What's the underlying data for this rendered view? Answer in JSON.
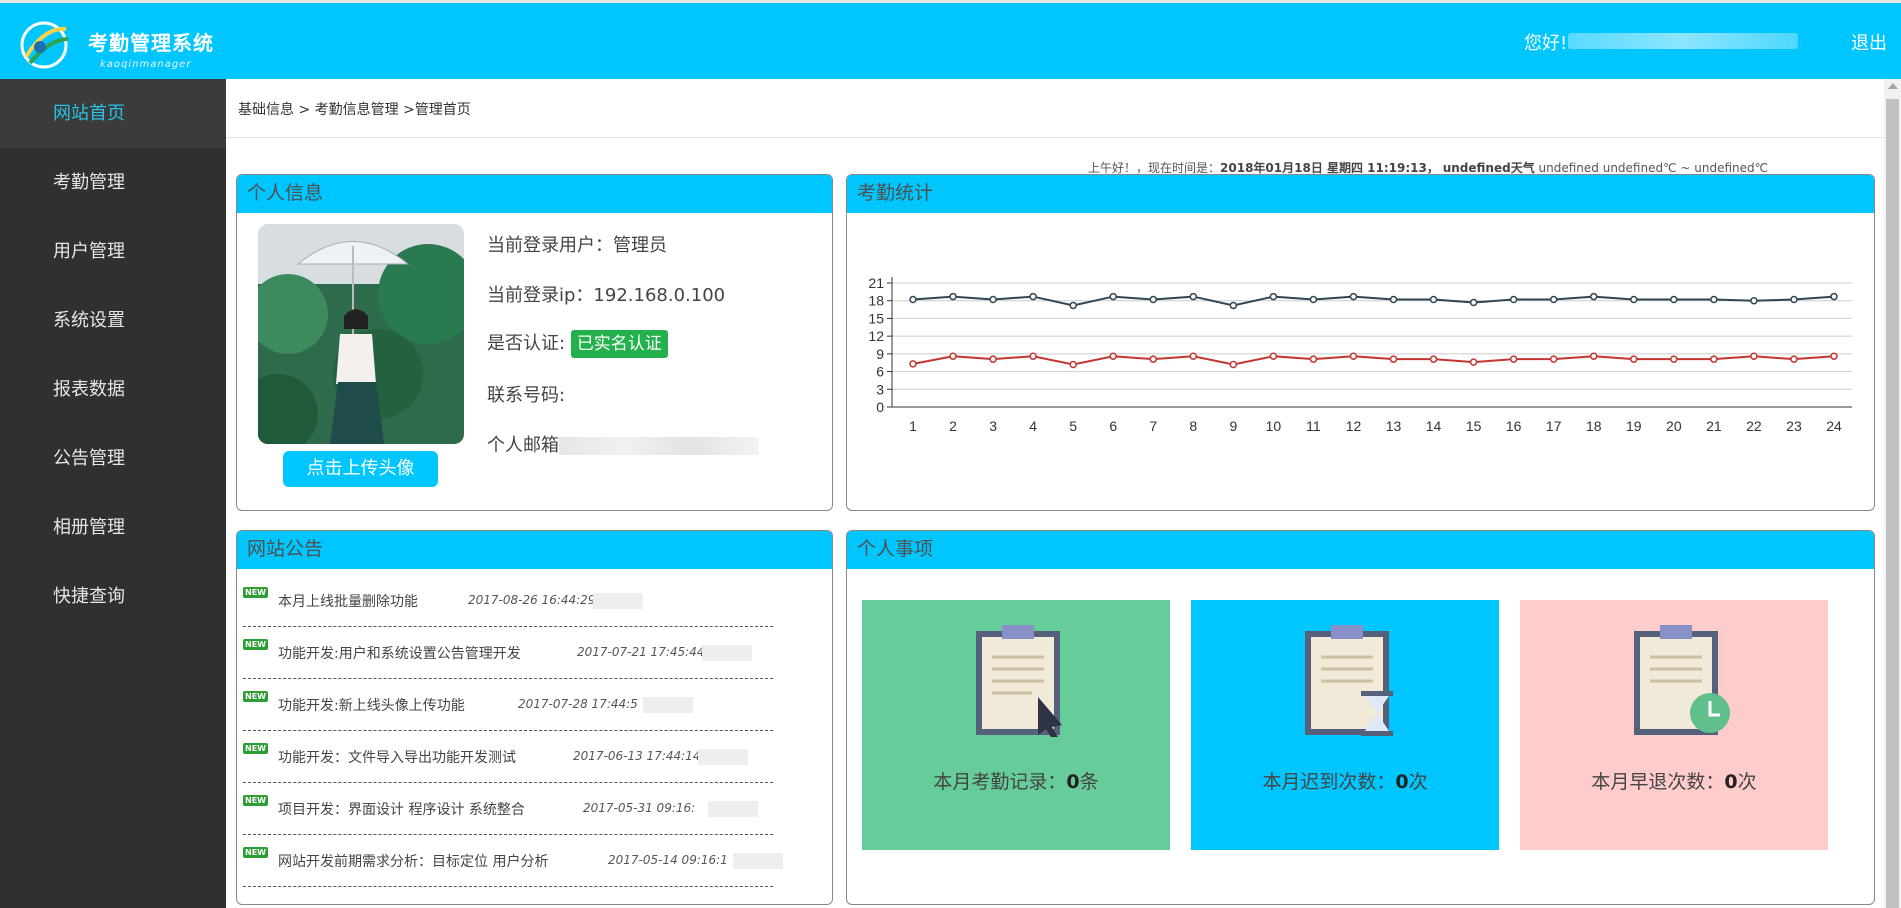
{
  "header": {
    "title": "考勤管理系统",
    "subtitle": "kaoqinmanager",
    "greeting": "您好!",
    "logout": "退出"
  },
  "sidebar": {
    "items": [
      {
        "label": "网站首页",
        "active": true
      },
      {
        "label": "考勤管理"
      },
      {
        "label": "用户管理"
      },
      {
        "label": "系统设置"
      },
      {
        "label": "报表数据"
      },
      {
        "label": "公告管理"
      },
      {
        "label": "相册管理"
      },
      {
        "label": "快捷查询"
      }
    ]
  },
  "breadcrumb": "基础信息 > 考勤信息管理 >管理首页",
  "timebar": {
    "prefix": "上午好！，现在时间是：",
    "datetime": "2018年01月18日 星期四 11:19:13",
    "sep": "，",
    "weather": "undefined天气",
    "temps": " undefined undefined℃ ~ undefined℃"
  },
  "profile": {
    "heading": "个人信息",
    "user": "当前登录用户：管理员",
    "ip": "当前登录ip：192.168.0.100",
    "auth_label": "是否认证:",
    "auth_badge": "已实名认证",
    "phone": "联系号码:",
    "email": "个人邮箱",
    "upload_button": "点击上传头像"
  },
  "stats": {
    "heading": "考勤统计"
  },
  "chart_data": {
    "type": "line",
    "x": [
      1,
      2,
      3,
      4,
      5,
      6,
      7,
      8,
      9,
      10,
      11,
      12,
      13,
      14,
      15,
      16,
      17,
      18,
      19,
      20,
      21,
      22,
      23,
      24
    ],
    "ylim": [
      0,
      21
    ],
    "yticks": [
      0,
      3,
      6,
      9,
      12,
      15,
      18,
      21
    ],
    "grid": true,
    "series": [
      {
        "color": "#2f4554",
        "values": [
          18.2,
          18.7,
          18.2,
          18.7,
          17.2,
          18.7,
          18.2,
          18.7,
          17.2,
          18.7,
          18.2,
          18.7,
          18.2,
          18.2,
          17.7,
          18.2,
          18.2,
          18.7,
          18.2,
          18.2,
          18.2,
          18.0,
          18.2,
          18.7
        ]
      },
      {
        "color": "#c23531",
        "values": [
          7.3,
          8.6,
          8.1,
          8.6,
          7.2,
          8.6,
          8.1,
          8.6,
          7.2,
          8.6,
          8.1,
          8.6,
          8.1,
          8.1,
          7.6,
          8.1,
          8.1,
          8.6,
          8.1,
          8.1,
          8.1,
          8.6,
          8.1,
          8.6
        ]
      }
    ]
  },
  "notices": {
    "heading": "网站公告",
    "new_label": "NEW",
    "items": [
      {
        "title": "本月上线批量删除功能",
        "date": "2017-08-26 16:44:29"
      },
      {
        "title": "功能开发:用户和系统设置公告管理开发",
        "date": "2017-07-21 17:45:44"
      },
      {
        "title": "功能开发:新上线头像上传功能",
        "date": "2017-07-28 17:44:5"
      },
      {
        "title": "功能开发：文件导入导出功能开发测试",
        "date": "2017-06-13 17:44:14"
      },
      {
        "title": "项目开发：界面设计 程序设计 系统整合",
        "date": "2017-05-31 09:16:"
      },
      {
        "title": "网站开发前期需求分析：目标定位 用户分析",
        "date": "2017-05-14 09:16:1"
      }
    ]
  },
  "personal": {
    "heading": "个人事项",
    "cards": [
      {
        "label": "本月考勤记录：",
        "count": "0",
        "unit": "条",
        "color": "#66cc99",
        "icon": "clipboard-cursor-icon"
      },
      {
        "label": "本月迟到次数：",
        "count": "0",
        "unit": "次",
        "color": "#00c6ff",
        "icon": "clipboard-hourglass-icon"
      },
      {
        "label": "本月早退次数：",
        "count": "0",
        "unit": "次",
        "color": "#ffcccc",
        "icon": "clipboard-clock-icon"
      }
    ]
  }
}
